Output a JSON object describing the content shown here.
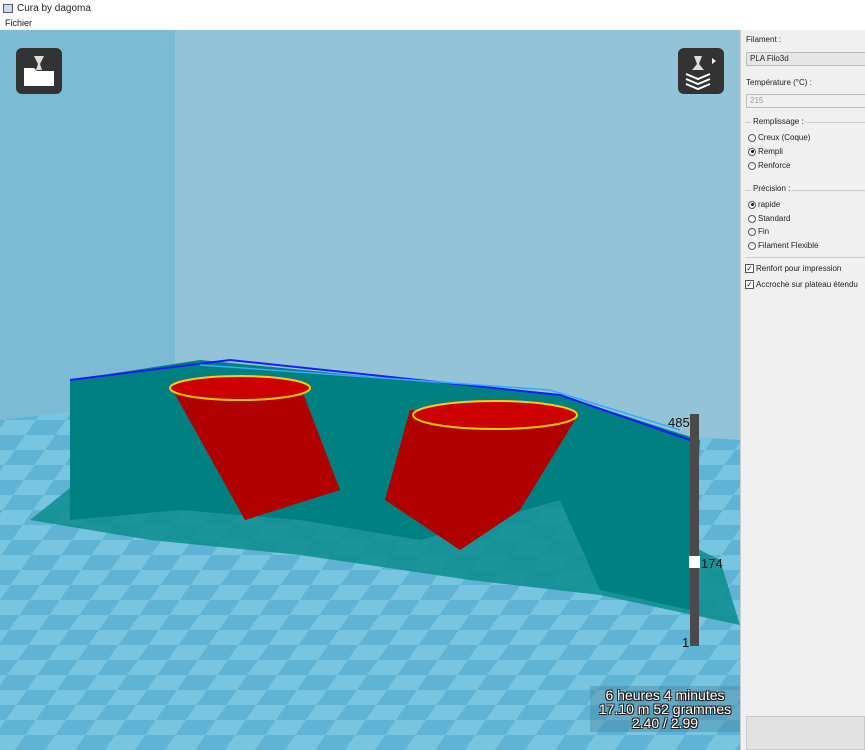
{
  "window": {
    "title": "Cura by dagoma"
  },
  "menu": {
    "file": "Fichier"
  },
  "viewport": {
    "layer_slider": {
      "max": "485",
      "current": "174",
      "min": "1",
      "value_fraction": 0.357
    },
    "stats": {
      "time": "6 heures 4 minutes",
      "material": "17.10 m 52 grammes",
      "cost": "2.40 / 2.99"
    }
  },
  "panel": {
    "filament_label": "Filament :",
    "filament_value": "PLA Filo3d",
    "temperature_label": "Température (°C) :",
    "temperature_value": "215",
    "fill_title": "Remplissage :",
    "fill_options": [
      "Creux (Coque)",
      "Rempli",
      "Renforce"
    ],
    "fill_selected": 1,
    "precision_title": "Précision :",
    "precision_options": [
      "rapide",
      "Standard",
      "Fin",
      "Filament Flexible"
    ],
    "precision_selected": 0,
    "support_label": "Renfort pour impression",
    "brim_label": "Accroche sur plateau étendu"
  },
  "colors": {
    "wall": "#008080",
    "shell": "#c00000",
    "travel": "#1a1aff",
    "floor": "#63b8d8"
  }
}
